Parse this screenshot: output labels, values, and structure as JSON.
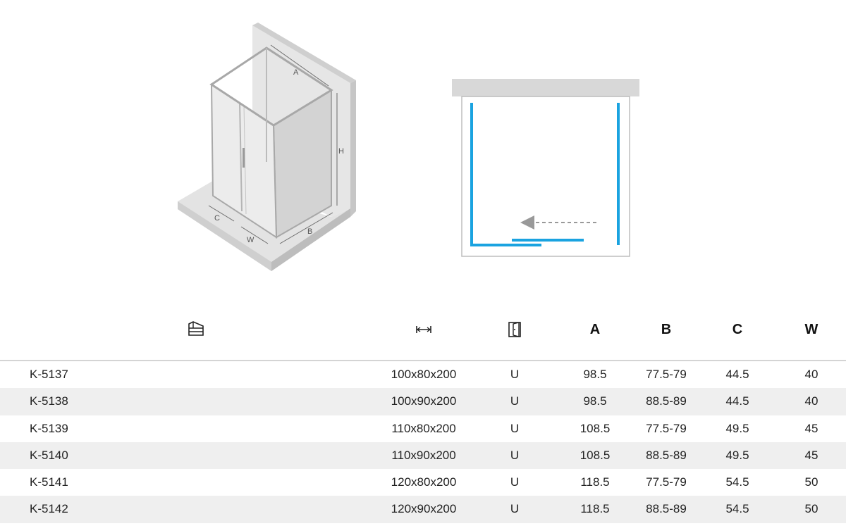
{
  "diagram": {
    "iso_labels": {
      "a": "A",
      "b": "B",
      "c": "C",
      "w": "W",
      "h": "H"
    }
  },
  "table": {
    "headers": {
      "model_icon": "shower-tray-icon",
      "size_icon": "width-arrows-icon",
      "door_icon": "door-icon",
      "a": "A",
      "b": "B",
      "c": "C",
      "w": "W"
    },
    "rows": [
      {
        "code": "K-5137",
        "size": "100x80x200",
        "door": "U",
        "a": "98.5",
        "b": "77.5-79",
        "c": "44.5",
        "w": "40"
      },
      {
        "code": "K-5138",
        "size": "100x90x200",
        "door": "U",
        "a": "98.5",
        "b": "88.5-89",
        "c": "44.5",
        "w": "40"
      },
      {
        "code": "K-5139",
        "size": "110x80x200",
        "door": "U",
        "a": "108.5",
        "b": "77.5-79",
        "c": "49.5",
        "w": "45"
      },
      {
        "code": "K-5140",
        "size": "110x90x200",
        "door": "U",
        "a": "108.5",
        "b": "88.5-89",
        "c": "49.5",
        "w": "45"
      },
      {
        "code": "K-5141",
        "size": "120x80x200",
        "door": "U",
        "a": "118.5",
        "b": "77.5-79",
        "c": "54.5",
        "w": "50"
      },
      {
        "code": "K-5142",
        "size": "120x90x200",
        "door": "U",
        "a": "118.5",
        "b": "88.5-89",
        "c": "54.5",
        "w": "50"
      }
    ]
  },
  "colors": {
    "glass_frame": "#aaaaaa",
    "plan_glass": "#1aa3e0",
    "wall": "#d8d8d8",
    "row_alt": "#efefef"
  }
}
